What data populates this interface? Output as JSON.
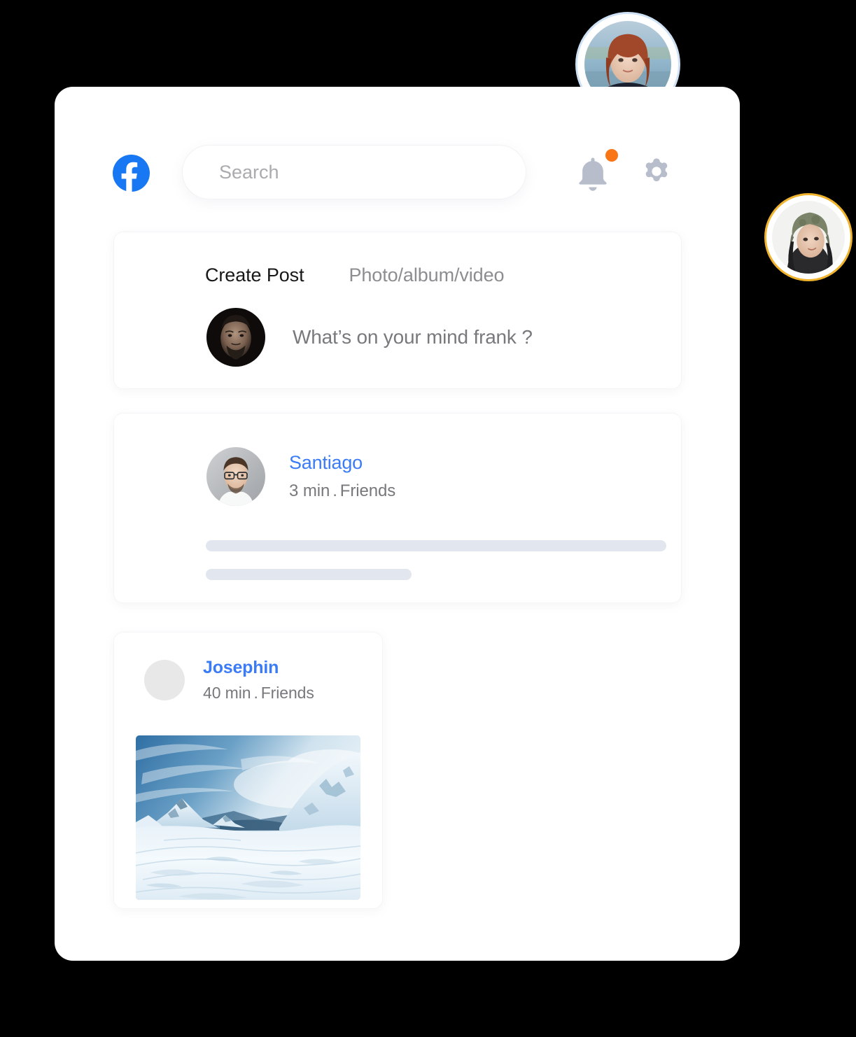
{
  "theme": {
    "page_background": "#000000",
    "panel_background": "#ffffff",
    "brand_blue": "#3b7cf6",
    "facebook_blue": "#1877f2",
    "notification_orange": "#f97516",
    "muted_text": "#76787c",
    "placeholder_bar": "#e1e6ef",
    "top_avatar_ring": "#cfe1f5",
    "side_avatar_ring": "#f0b32e"
  },
  "header": {
    "logo_icon": "facebook-logo-icon",
    "search": {
      "placeholder": "Search",
      "value": ""
    },
    "notifications": {
      "icon": "bell-icon",
      "has_unread": true,
      "badge_icon": "notification-dot-icon"
    },
    "settings": {
      "icon": "gear-icon"
    }
  },
  "create_post_card": {
    "tabs": [
      {
        "label": "Create Post",
        "active": true
      },
      {
        "label": "Photo/album/video",
        "active": false
      }
    ],
    "tab_create_post": "Create Post",
    "tab_photo_album": "Photo/album/video",
    "composer": {
      "avatar_name": "frank-avatar",
      "prompt": "What’s on your mind frank ?"
    }
  },
  "feed": {
    "posts": [
      {
        "author": "Santiago",
        "time": "3 min",
        "separator": ".",
        "audience": "Friends",
        "avatar_name": "santiago-avatar",
        "body_type": "placeholder-lines",
        "placeholder_lines": 2
      },
      {
        "author": "Josephin",
        "time": "40 min",
        "separator": ".",
        "audience": "Friends",
        "avatar_name": "josephin-avatar",
        "body_type": "photo",
        "photo_alt": "snow-covered mountain landscape"
      }
    ]
  },
  "floating_avatars": [
    {
      "name": "top-right-floating-avatar",
      "ring_color": "#cfe1f5",
      "description": "red-haired woman portrait"
    },
    {
      "name": "right-side-floating-avatar",
      "ring_color": "#f0b32e",
      "description": "woman wearing knit hat"
    }
  ]
}
